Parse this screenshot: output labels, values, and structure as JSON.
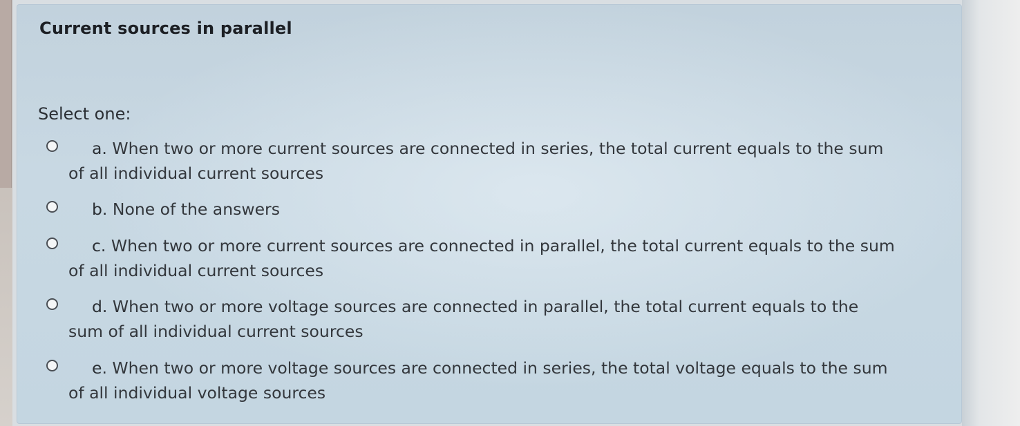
{
  "question": {
    "title": "Current sources in parallel",
    "prompt": "Select one:",
    "options": [
      {
        "letter": "a.",
        "text": "When two or more current sources are connected in series, the total current equals to the sum of all individual current sources"
      },
      {
        "letter": "b.",
        "text": "None of the answers"
      },
      {
        "letter": "c.",
        "text": "When two or more current sources are connected in parallel, the total current equals to the sum of all individual current sources"
      },
      {
        "letter": "d.",
        "text": "When two or more voltage sources are connected in parallel, the total current equals to the sum of all individual current sources"
      },
      {
        "letter": "e.",
        "text": "When two or more voltage sources are connected in series, the total voltage equals to the sum of all individual voltage sources"
      }
    ]
  },
  "colors": {
    "card_background": "#c4d6e1",
    "text": "#33373c",
    "title": "#1c1f24"
  },
  "icons": {
    "option_selector": "radio-button-icon"
  }
}
